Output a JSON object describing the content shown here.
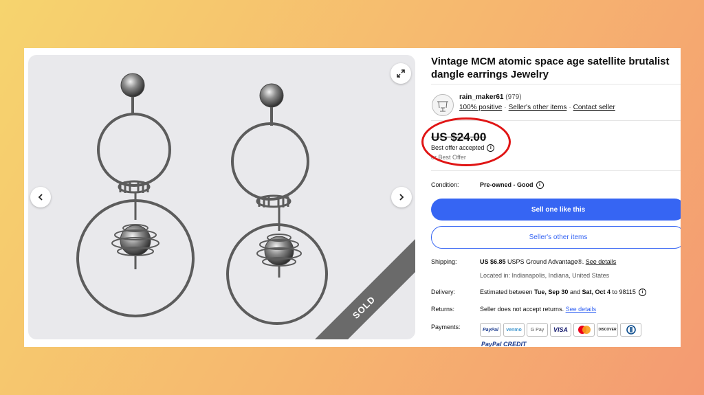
{
  "listing": {
    "title": "Vintage MCM atomic space age satellite brutalist dangle earrings Jewelry",
    "sold_banner": "SOLD"
  },
  "seller": {
    "name": "rain_maker61",
    "feedback_count": "(979)",
    "positive": "100% positive",
    "other_items": "Seller's other items",
    "contact": "Contact seller"
  },
  "price": {
    "value": "US $24.00",
    "status": "Best offer accepted",
    "or_best_offer": "or Best Offer",
    "highlight_color": "#e01515"
  },
  "condition": {
    "label": "Condition:",
    "value": "Pre-owned - Good"
  },
  "buttons": {
    "sell_one": "Sell one like this",
    "other_items": "Seller's other items"
  },
  "shipping": {
    "label": "Shipping:",
    "cost": "US $6.85",
    "service": "USPS Ground Advantage®.",
    "details": "See details",
    "location": "Located in: Indianapolis, Indiana, United States"
  },
  "delivery": {
    "label": "Delivery:",
    "prefix": "Estimated between",
    "start": "Tue, Sep 30",
    "and": "and",
    "end": "Sat, Oct 4",
    "to": "to 98115"
  },
  "returns": {
    "label": "Returns:",
    "text": "Seller does not accept returns.",
    "details": "See details"
  },
  "payments": {
    "label": "Payments:",
    "methods": [
      "PayPal",
      "venmo",
      "G Pay",
      "VISA",
      "MC",
      "DISCOVER",
      "Diners"
    ],
    "paypal_credit": "PayPal CREDIT"
  },
  "colors": {
    "accent": "#3665f3"
  }
}
